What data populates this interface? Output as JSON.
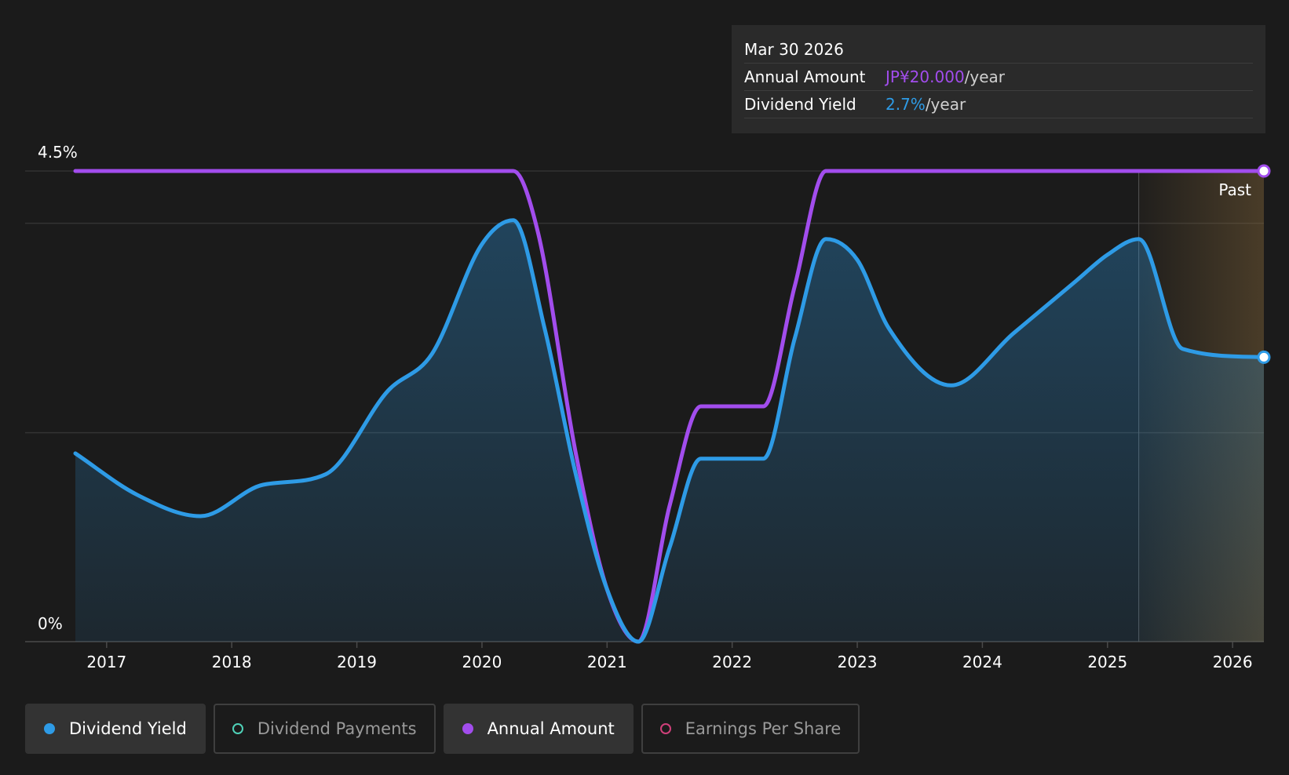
{
  "tooltip": {
    "date": "Mar 30 2026",
    "annual_label": "Annual Amount",
    "annual_value": "JP¥20.000",
    "annual_unit": "/year",
    "yield_label": "Dividend Yield",
    "yield_value": "2.7%",
    "yield_unit": "/year"
  },
  "past_label": "Past",
  "legend": [
    {
      "label": "Dividend Yield",
      "color": "#2e9be6",
      "active": true,
      "filled": true
    },
    {
      "label": "Dividend Payments",
      "color": "#4fd1b8",
      "active": false,
      "filled": false
    },
    {
      "label": "Annual Amount",
      "color": "#a24ded",
      "active": true,
      "filled": true
    },
    {
      "label": "Earnings Per Share",
      "color": "#d0407a",
      "active": false,
      "filled": false
    }
  ],
  "chart_data": {
    "type": "line",
    "title": "",
    "xlabel": "",
    "ylabel": "",
    "ylim": [
      0,
      4.5
    ],
    "y_tick_labels": [
      "0%",
      "4.5%"
    ],
    "x_tick_labels": [
      "2017",
      "2018",
      "2019",
      "2020",
      "2021",
      "2022",
      "2023",
      "2024",
      "2025",
      "2026"
    ],
    "xlim": [
      2016.75,
      2026.25
    ],
    "forecast_start": 2025.25,
    "colors": {
      "dividend_yield": "#2e9be6",
      "annual_amount": "#a24ded",
      "grid": "#333333",
      "background": "#1b1b1b"
    },
    "series": [
      {
        "name": "Dividend Yield",
        "x": [
          2016.75,
          2017.25,
          2017.75,
          2018.25,
          2018.75,
          2019.25,
          2019.6,
          2020.0,
          2020.25,
          2020.5,
          2020.75,
          2021.0,
          2021.25,
          2021.5,
          2021.75,
          2022.25,
          2022.5,
          2022.75,
          2023.0,
          2023.25,
          2023.75,
          2024.25,
          2024.75,
          2025.0,
          2025.25,
          2025.6,
          2026.25
        ],
        "values": [
          1.8,
          1.4,
          1.2,
          1.5,
          1.6,
          2.4,
          2.75,
          3.8,
          4.03,
          3.0,
          1.6,
          0.5,
          0.0,
          0.9,
          1.75,
          1.75,
          2.9,
          3.85,
          3.65,
          3.0,
          2.45,
          2.95,
          3.45,
          3.7,
          3.85,
          2.8,
          2.72
        ]
      },
      {
        "name": "Annual Amount",
        "x": [
          2016.75,
          2020.25,
          2020.45,
          2020.75,
          2021.0,
          2021.25,
          2021.5,
          2021.75,
          2022.25,
          2022.5,
          2022.75,
          2026.25
        ],
        "values": [
          4.5,
          4.5,
          3.9,
          1.8,
          0.5,
          0.0,
          1.3,
          2.25,
          2.25,
          3.4,
          4.5,
          4.5
        ]
      }
    ]
  }
}
